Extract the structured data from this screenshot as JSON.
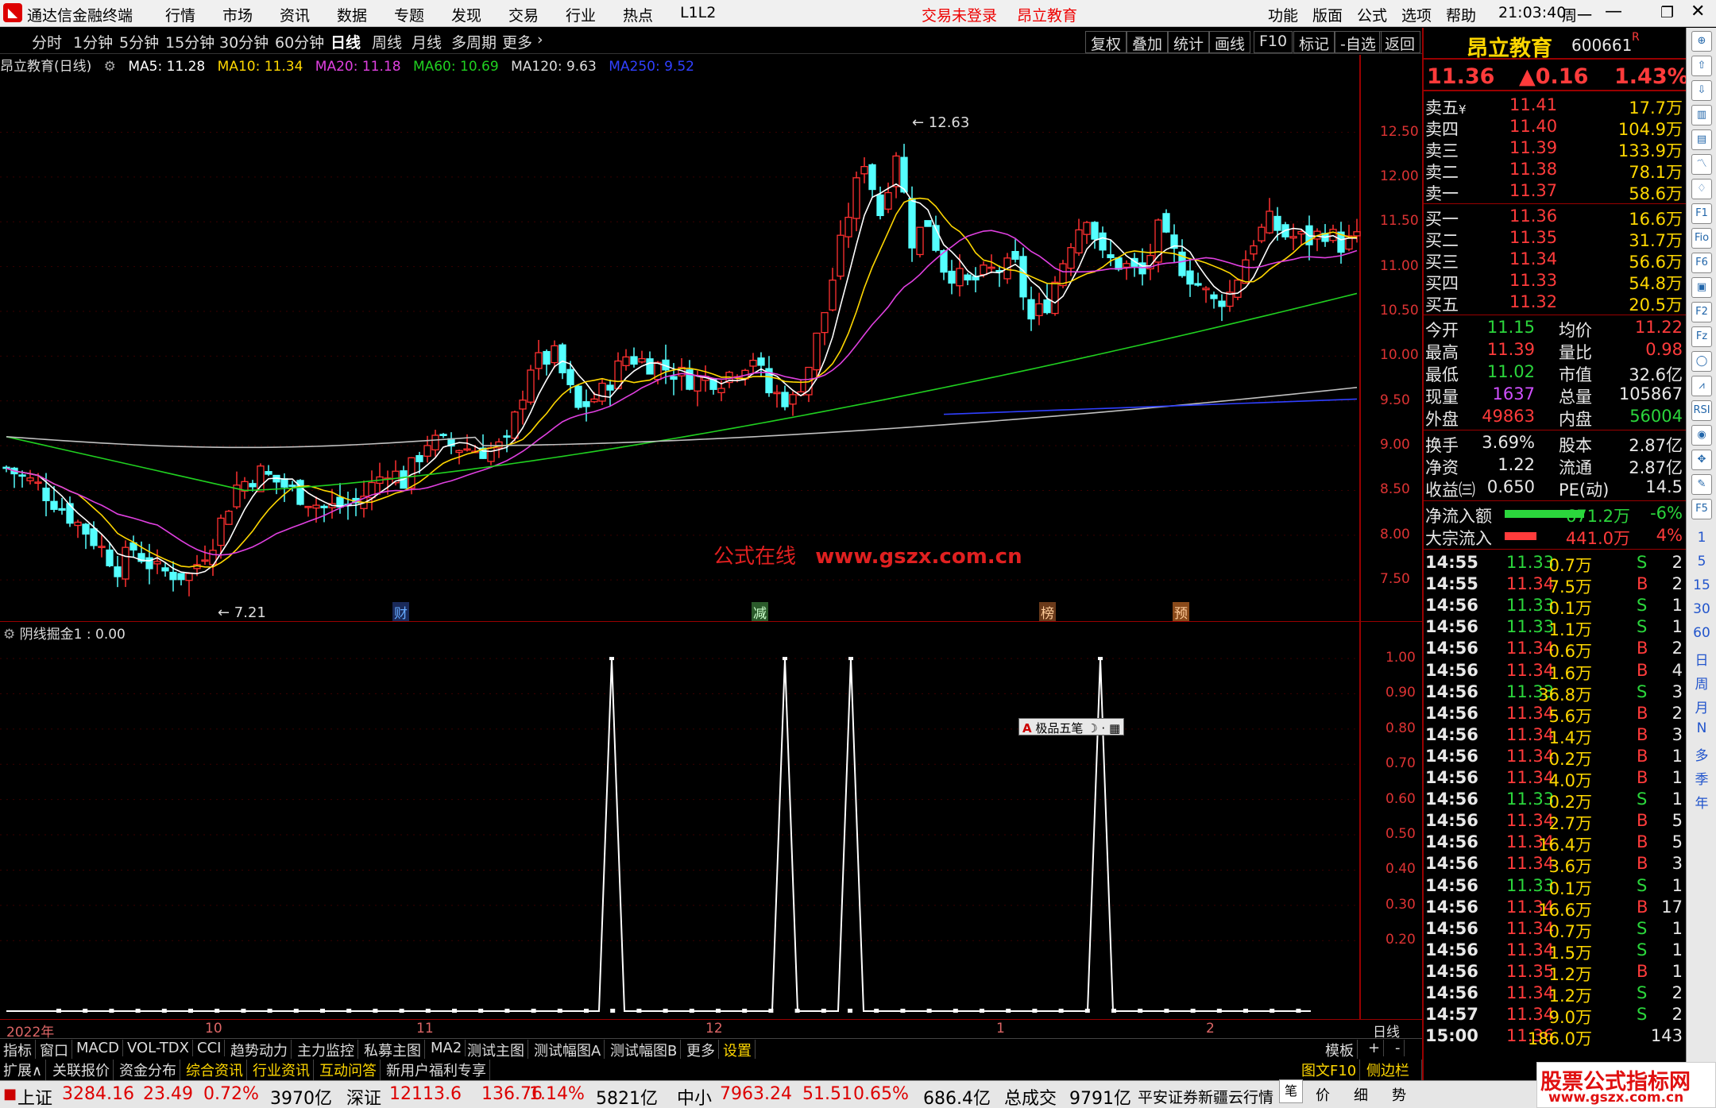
{
  "app": {
    "title": "通达信金融终端",
    "menus": [
      "行情",
      "市场",
      "资讯",
      "数据",
      "专题",
      "发现",
      "交易",
      "行业",
      "热点",
      "L1L2"
    ],
    "notice": [
      "交易未登录",
      "昂立教育"
    ],
    "right_menus": [
      "功能",
      "版面",
      "公式",
      "选项",
      "帮助"
    ],
    "time": "21:03:40",
    "weekday": "周一"
  },
  "periods": [
    "分时",
    "1分钟",
    "5分钟",
    "15分钟",
    "30分钟",
    "60分钟",
    "日线",
    "周线",
    "月线",
    "多周期",
    "更多"
  ],
  "selected_period": "日线",
  "chart_buttons": [
    "复权",
    "叠加",
    "统计",
    "画线",
    "F10",
    "标记",
    "-自选",
    "返回"
  ],
  "ma_legend": {
    "name": "昂立教育(日线)",
    "ma5": "MA5: 11.28",
    "ma10": "MA10: 11.34",
    "ma20": "MA20: 11.18",
    "ma60": "MA60: 10.69",
    "ma120": "MA120: 9.63",
    "ma250": "MA250: 9.52",
    "colors": {
      "ma5": "#ffffff",
      "ma10": "#ffd700",
      "ma20": "#e040e0",
      "ma60": "#20d020",
      "ma120": "#c0c0c0",
      "ma250": "#3040ff"
    }
  },
  "chart_data": {
    "type": "candlestick",
    "y_ticks": [
      "12.50",
      "12.00",
      "11.50",
      "11.00",
      "10.50",
      "10.00",
      "9.50",
      "9.00",
      "8.50",
      "8.00",
      "7.50"
    ],
    "ylim": [
      7.2,
      12.7
    ],
    "high_label": "12.63",
    "low_label": "7.21",
    "x_labels": [
      "2022年",
      "10",
      "11",
      "12",
      "1",
      "2"
    ],
    "event_markers": [
      "财",
      "减",
      "榜",
      "预"
    ],
    "indicator": {
      "name": "阴线掘金1 : 0.00",
      "y_ticks": [
        "1.00",
        "0.90",
        "0.80",
        "0.70",
        "0.60",
        "0.50",
        "0.40",
        "0.30",
        "0.20"
      ],
      "spike_bars": [
        58,
        71,
        76,
        95
      ],
      "values_note": "0 or 1"
    }
  },
  "watermark": {
    "cn": "公式在线",
    "url": "www.gszx.com.cn"
  },
  "ime_box": "极品五笔",
  "quote": {
    "name": "昂立教育",
    "code": "600661",
    "flag": "R",
    "price": "11.36",
    "change": "▲0.16",
    "pct": "1.43%",
    "asks": [
      {
        "label": "卖五",
        "price": "11.41",
        "vol": "17.7万"
      },
      {
        "label": "卖四",
        "price": "11.40",
        "vol": "104.9万"
      },
      {
        "label": "卖三",
        "price": "11.39",
        "vol": "133.9万"
      },
      {
        "label": "卖二",
        "price": "11.38",
        "vol": "78.1万"
      },
      {
        "label": "卖一",
        "price": "11.37",
        "vol": "58.6万"
      }
    ],
    "ask_mark": "¥",
    "bids": [
      {
        "label": "买一",
        "price": "11.36",
        "vol": "16.6万"
      },
      {
        "label": "买二",
        "price": "11.35",
        "vol": "31.7万"
      },
      {
        "label": "买三",
        "price": "11.34",
        "vol": "56.6万"
      },
      {
        "label": "买四",
        "price": "11.33",
        "vol": "54.8万"
      },
      {
        "label": "买五",
        "price": "11.32",
        "vol": "20.5万"
      }
    ],
    "stats1": [
      {
        "l": "今开",
        "v": "11.15",
        "l2": "均价",
        "v2": "11.22"
      },
      {
        "l": "最高",
        "v": "11.39",
        "l2": "量比",
        "v2": "0.98"
      },
      {
        "l": "最低",
        "v": "11.02",
        "l2": "市值",
        "v2": "32.6亿"
      },
      {
        "l": "现量",
        "v": "1637",
        "l2": "总量",
        "v2": "105867"
      },
      {
        "l": "外盘",
        "v": "49863",
        "l2": "内盘",
        "v2": "56004"
      }
    ],
    "stats2": [
      {
        "l": "换手",
        "v": "3.69%",
        "l2": "股本",
        "v2": "2.87亿"
      },
      {
        "l": "净资",
        "v": "1.22",
        "l2": "流通",
        "v2": "2.87亿"
      },
      {
        "l": "收益㈢",
        "v": "0.650",
        "l2": "PE(动)",
        "v2": "14.5"
      }
    ],
    "flows": [
      {
        "l": "净流入额",
        "v": "-671.2万",
        "p": "-6%",
        "color": "#2bd63c"
      },
      {
        "l": "大宗流入",
        "v": "441.0万",
        "p": "4%",
        "color": "#ff3b3b"
      }
    ],
    "ticks": [
      [
        "14:55",
        "11.33",
        "0.7万",
        "S",
        "2"
      ],
      [
        "14:55",
        "11.34",
        "7.5万",
        "B",
        "2"
      ],
      [
        "14:56",
        "11.33",
        "0.1万",
        "S",
        "1"
      ],
      [
        "14:56",
        "11.33",
        "1.1万",
        "S",
        "1"
      ],
      [
        "14:56",
        "11.34",
        "0.6万",
        "B",
        "2"
      ],
      [
        "14:56",
        "11.34",
        "1.6万",
        "B",
        "4"
      ],
      [
        "14:56",
        "11.33",
        "36.8万",
        "S",
        "3"
      ],
      [
        "14:56",
        "11.34",
        "5.6万",
        "B",
        "2"
      ],
      [
        "14:56",
        "11.34",
        "1.4万",
        "B",
        "3"
      ],
      [
        "14:56",
        "11.34",
        "0.2万",
        "B",
        "1"
      ],
      [
        "14:56",
        "11.34",
        "4.0万",
        "B",
        "1"
      ],
      [
        "14:56",
        "11.33",
        "0.2万",
        "S",
        "1"
      ],
      [
        "14:56",
        "11.34",
        "2.7万",
        "B",
        "5"
      ],
      [
        "14:56",
        "11.34",
        "16.4万",
        "B",
        "5"
      ],
      [
        "14:56",
        "11.34",
        "3.6万",
        "B",
        "3"
      ],
      [
        "14:56",
        "11.33",
        "0.1万",
        "S",
        "1"
      ],
      [
        "14:56",
        "11.34",
        "16.6万",
        "B",
        "17"
      ],
      [
        "14:56",
        "11.34",
        "0.7万",
        "S",
        "1"
      ],
      [
        "14:56",
        "11.34",
        "1.5万",
        "S",
        "1"
      ],
      [
        "14:56",
        "11.35",
        "1.2万",
        "B",
        "1"
      ],
      [
        "14:56",
        "11.34",
        "1.2万",
        "S",
        "2"
      ],
      [
        "14:57",
        "11.34",
        "9.0万",
        "S",
        "2"
      ],
      [
        "15:00",
        "11.36",
        "186.0万",
        "",
        "143"
      ]
    ]
  },
  "right_toolbar_labels": [
    "1",
    "5",
    "15",
    "30",
    "60",
    "日",
    "周",
    "月",
    "N",
    "多",
    "季",
    "年"
  ],
  "tabs1": [
    "指标",
    "窗口",
    "MACD",
    "VOL-TDX",
    "CCI",
    "趋势动力",
    "主力监控",
    "私募主图",
    "MA2",
    "测试主图",
    "测试幅图A",
    "测试幅图B",
    "更多",
    "设置"
  ],
  "tabs1_right": [
    "模板",
    "+",
    "-"
  ],
  "tabs2": [
    "扩展∧",
    "关联报价",
    "资金分布",
    "综合资讯",
    "行业资讯",
    "互动问答",
    "新用户福利专享"
  ],
  "tabs2_right": [
    "图文F10",
    "侧边栏《",
    "笔",
    "价",
    "细",
    "势"
  ],
  "period_label_right": "日线",
  "status": {
    "sh_name": "上证",
    "sh": "3284.16",
    "sh_chg": "23.49",
    "sh_pct": "0.72%",
    "sh_amt": "3970亿",
    "sz_name": "深证",
    "sz": "12113.6",
    "sz_chg": "136.76",
    "sz_pct": "1.14%",
    "sz_amt": "5821亿",
    "zx_name": "中小",
    "zx": "7963.24",
    "zx_chg": "51.51",
    "zx_pct": "0.65%",
    "zx_amt": "686.4亿",
    "total_label": "总成交",
    "total": "9791亿",
    "broker": "平安证券新疆云行情",
    "brand": "股票公式指标网",
    "brand_url": "www.gszx.com.cn"
  }
}
